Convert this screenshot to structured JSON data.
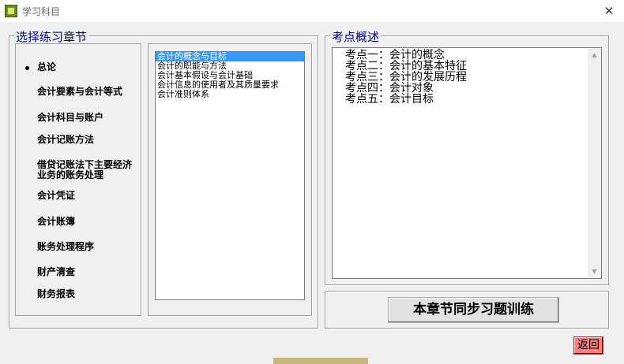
{
  "window": {
    "title": "学习科目",
    "close_symbol": "✕"
  },
  "chapters": {
    "legend": "选择练习章节",
    "items": [
      {
        "label": "总论",
        "checked": true
      },
      {
        "label": "会计要素与会计等式",
        "checked": false
      },
      {
        "label": "会计科目与账户",
        "checked": false
      },
      {
        "label": "会计记账方法",
        "checked": false
      },
      {
        "label": "借贷记账法下主要经济业务的账务处理",
        "checked": false
      },
      {
        "label": "会计凭证",
        "checked": false
      },
      {
        "label": "会计账簿",
        "checked": false
      },
      {
        "label": "账务处理程序",
        "checked": false
      },
      {
        "label": "财产清查",
        "checked": false
      },
      {
        "label": "财务报表",
        "checked": false
      }
    ]
  },
  "sections": {
    "items": [
      {
        "label": "会计的概念与目标",
        "selected": true
      },
      {
        "label": "会计的职能与方法",
        "selected": false
      },
      {
        "label": "会计基本假设与会计基础",
        "selected": false
      },
      {
        "label": "会计信息的使用者及其质量要求",
        "selected": false
      },
      {
        "label": "会计准则体系",
        "selected": false
      }
    ]
  },
  "points": {
    "legend": "考点概述",
    "lines": [
      "考点一：会计的概念",
      "考点二：会计的基本特征",
      "考点三：会计的发展历程",
      "考点四：会计对象",
      "考点五：会计目标"
    ]
  },
  "buttons": {
    "train": "本章节同步习题训练",
    "back": "返回"
  },
  "colors": {
    "legend": "#00008b",
    "selection": "#3399ff",
    "back_button": "#ff7f7f"
  }
}
